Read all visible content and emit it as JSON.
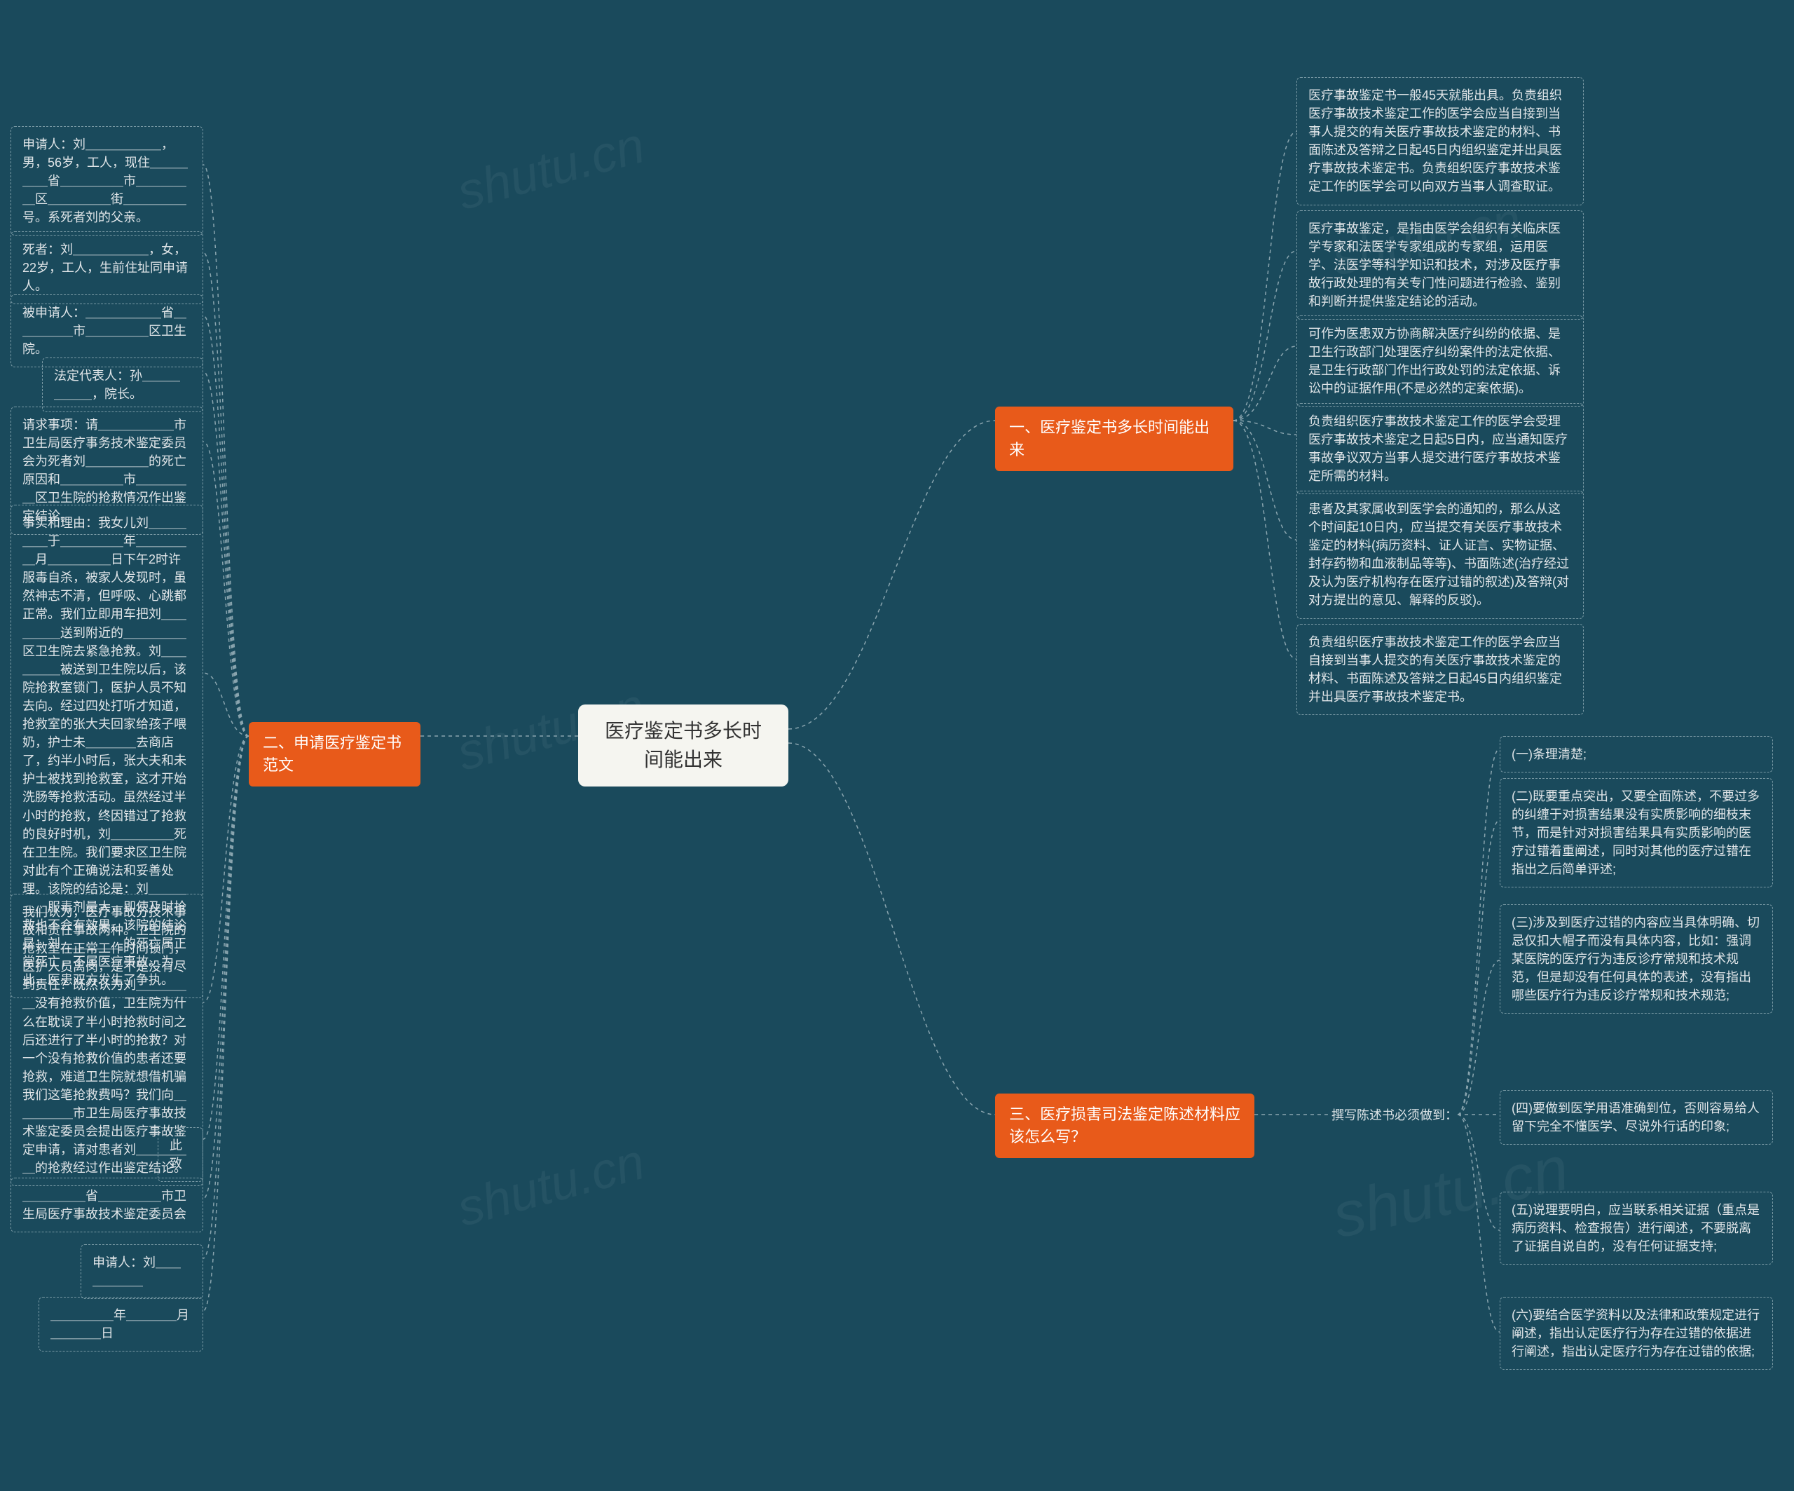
{
  "watermark": "shutu.cn",
  "center": {
    "title": "医疗鉴定书多长时间能出来"
  },
  "branches": {
    "b1": {
      "label": "一、医疗鉴定书多长时间能出来",
      "leaves": [
        "医疗事故鉴定书一般45天就能出具。负责组织医疗事故技术鉴定工作的医学会应当自接到当事人提交的有关医疗事故技术鉴定的材料、书面陈述及答辩之日起45日内组织鉴定并出具医疗事故技术鉴定书。负责组织医疗事故技术鉴定工作的医学会可以向双方当事人调查取证。",
        "医疗事故鉴定，是指由医学会组织有关临床医学专家和法医学专家组成的专家组，运用医学、法医学等科学知识和技术，对涉及医疗事故行政处理的有关专门性问题进行检验、鉴别和判断并提供鉴定结论的活动。",
        "可作为医患双方协商解决医疗纠纷的依据、是卫生行政部门处理医疗纠纷案件的法定依据、是卫生行政部门作出行政处罚的法定依据、诉讼中的证据作用(不是必然的定案依据)。",
        "负责组织医疗事故技术鉴定工作的医学会受理医疗事故技术鉴定之日起5日内，应当通知医疗事故争议双方当事人提交进行医疗事故技术鉴定所需的材料。",
        "患者及其家属收到医学会的通知的，那么从这个时间起10日内，应当提交有关医疗事故技术鉴定的材料(病历资料、证人证言、实物证据、封存药物和血液制品等等)、书面陈述(治疗经过及认为医疗机构存在医疗过错的叙述)及答辩(对对方提出的意见、解释的反驳)。",
        "负责组织医疗事故技术鉴定工作的医学会应当自接到当事人提交的有关医疗事故技术鉴定的材料、书面陈述及答辩之日起45日内组织鉴定并出具医疗事故技术鉴定书。"
      ]
    },
    "b2": {
      "label": "二、申请医疗鉴定书范文",
      "leaves": [
        "申请人：刘＿＿＿＿＿＿，男，56岁，工人，现住＿＿＿＿＿省＿＿＿＿＿市＿＿＿＿＿区＿＿＿＿＿街＿＿＿＿＿号。系死者刘的父亲。",
        "死者：刘＿＿＿＿＿＿，女，22岁，工人，生前住址同申请人。",
        "被申请人：＿＿＿＿＿＿省＿＿＿＿＿市＿＿＿＿＿区卫生院。",
        "法定代表人：孙＿＿＿＿＿＿，院长。",
        "请求事项：请＿＿＿＿＿＿市卫生局医疗事务技术鉴定委员会为死者刘＿＿＿＿＿的死亡原因和＿＿＿＿＿市＿＿＿＿＿区卫生院的抢救情况作出鉴定结论。",
        "事实和理由：我女儿刘＿＿＿＿＿于＿＿＿＿＿年＿＿＿＿＿月＿＿＿＿＿日下午2时许服毒自杀，被家人发现时，虽然神志不清，但呼吸、心跳都正常。我们立即用车把刘＿＿＿＿＿送到附近的＿＿＿＿＿区卫生院去紧急抢救。刘＿＿＿＿＿被送到卫生院以后，该院抢救室锁门，医护人员不知去向。经过四处打听才知道，抢救室的张大夫回家给孩子喂奶，护士未＿＿＿＿去商店了，约半小时后，张大夫和未护士被找到抢救室，这才开始洗肠等抢救活动。虽然经过半小时的抢救，终因错过了抢救的良好时机，刘＿＿＿＿＿死在卫生院。我们要求区卫生院对此有个正确说法和妥善处理。该院的结论是：刘＿＿＿＿＿服毒剂量大，即使及时抢救也不会有效果。该院的结论是：刘＿＿＿＿＿的死亡属正常死亡，不属医疗事故。为此，医患双方发生了争执。",
        "我们认为，医疗事故分技术事故和责任事故两种。卫生院的抢救室在正常工作时间锁门，医护人员离岗，是不是没有尽到责任？既然认为刘＿＿＿＿＿没有抢救价值，卫生院为什么在耽误了半小时抢救时间之后还进行了半小时的抢救？对一个没有抢救价值的患者还要抢救，难道卫生院就想借机骗我们这笔抢救费吗？我们向＿＿＿＿＿市卫生局医疗事故技术鉴定委员会提出医疗事故鉴定申请，请对患者刘＿＿＿＿＿的抢救经过作出鉴定结论。",
        "此致",
        "＿＿＿＿＿省＿＿＿＿＿市卫生局医疗事故技术鉴定委员会",
        "申请人：刘＿＿＿＿＿＿",
        "＿＿＿＿＿年＿＿＿＿月＿＿＿＿日"
      ]
    },
    "b3": {
      "label": "三、医疗损害司法鉴定陈述材料应该怎么写？",
      "sublabel": "撰写陈述书必须做到：",
      "leaves": [
        "(一)条理清楚;",
        "(二)既要重点突出，又要全面陈述，不要过多的纠缠于对损害结果没有实质影响的细枝末节，而是针对对损害结果具有实质影响的医疗过错着重阐述，同时对其他的医疗过错在指出之后简单评述;",
        "(三)涉及到医疗过错的内容应当具体明确、切忌仅扣大帽子而没有具体内容，比如：强调某医院的医疗行为违反诊疗常规和技术规范，但是却没有任何具体的表述，没有指出哪些医疗行为违反诊疗常规和技术规范;",
        "(四)要做到医学用语准确到位，否则容易给人留下完全不懂医学、尽说外行话的印象;",
        "(五)说理要明白，应当联系相关证据（重点是病历资料、检查报告）进行阐述，不要脱离了证据自说自的，没有任何证据支持;",
        "(六)要结合医学资料以及法律和政策规定进行阐述，指出认定医疗行为存在过错的依据进行阐述，指出认定医疗行为存在过错的依据;"
      ]
    }
  }
}
